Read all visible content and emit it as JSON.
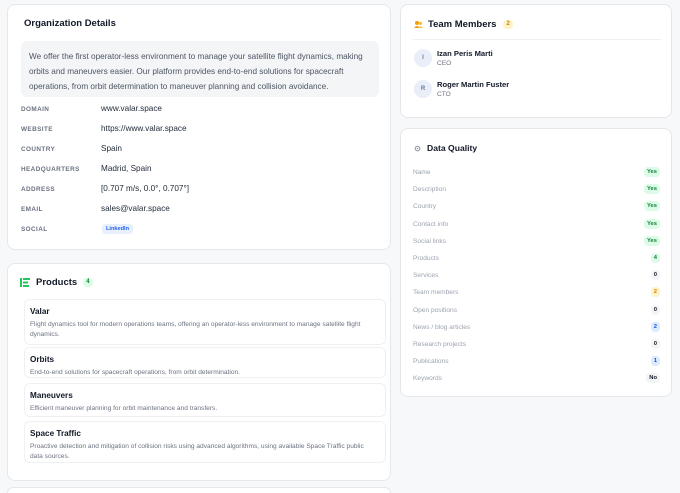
{
  "organization": {
    "title": "Organization Details",
    "description": "We offer the first operator-less environment to manage your satellite flight dynamics, making orbits and maneuvers easier. Our platform provides end-to-end solutions for spacecraft operations, from orbit determination to maneuver planning and collision avoidance.",
    "details": [
      {
        "key": "DOMAIN",
        "value": "www.valar.space"
      },
      {
        "key": "WEBSITE",
        "value": "https://www.valar.space"
      },
      {
        "key": "COUNTRY",
        "value": "Spain"
      },
      {
        "key": "HEADQUARTERS",
        "value": "Madrid, Spain"
      },
      {
        "key": "ADDRESS",
        "value": "[0.707 m/s, 0.0°, 0.707°]"
      },
      {
        "key": "EMAIL",
        "value": "sales@valar.space"
      },
      {
        "key": "SOCIAL",
        "value": "LinkedIn"
      }
    ]
  },
  "products": {
    "title": "Products",
    "count": "4",
    "items": [
      {
        "name": "Valar",
        "description": "Flight dynamics tool for modern operations teams, offering an operator-less environment to manage satellite flight dynamics."
      },
      {
        "name": "Orbits",
        "description": "End-to-end solutions for spacecraft operations, from orbit determination."
      },
      {
        "name": "Maneuvers",
        "description": "Efficient maneuver planning for orbit maintenance and transfers."
      },
      {
        "name": "Space Traffic",
        "description": "Proactive detection and mitigation of collision risks using advanced algorithms, using available Space Traffic public data sources."
      }
    ]
  },
  "team": {
    "title": "Team Members",
    "count": "2",
    "members": [
      {
        "initial": "I",
        "name": "Izan Peris Marti",
        "role": "CEO"
      },
      {
        "initial": "R",
        "name": "Roger Martin Fuster",
        "role": "CTO"
      }
    ]
  },
  "data_quality": {
    "title": "Data Quality",
    "rows": [
      {
        "label": "Name",
        "value": "Yes",
        "status": "green"
      },
      {
        "label": "Description",
        "value": "Yes",
        "status": "green"
      },
      {
        "label": "Country",
        "value": "Yes",
        "status": "green"
      },
      {
        "label": "Contact info",
        "value": "Yes",
        "status": "green"
      },
      {
        "label": "Social links",
        "value": "Yes",
        "status": "green"
      },
      {
        "label": "Products",
        "value": "4",
        "status": "green"
      },
      {
        "label": "Services",
        "value": "0",
        "status": "grey"
      },
      {
        "label": "Team members",
        "value": "2",
        "status": "amber"
      },
      {
        "label": "Open positions",
        "value": "0",
        "status": "grey"
      },
      {
        "label": "News / blog articles",
        "value": "2",
        "status": "blue"
      },
      {
        "label": "Research projects",
        "value": "0",
        "status": "grey"
      },
      {
        "label": "Publications",
        "value": "1",
        "status": "blue"
      },
      {
        "label": "Keywords",
        "value": "No",
        "status": "grey"
      }
    ]
  },
  "colors": {
    "accent_green": "#22c55e",
    "accent_amber": "#f59e0b",
    "accent_blue": "#2563eb"
  },
  "icons": {
    "products": "list-icon",
    "team": "people-icon",
    "data_quality": "gear-icon"
  }
}
